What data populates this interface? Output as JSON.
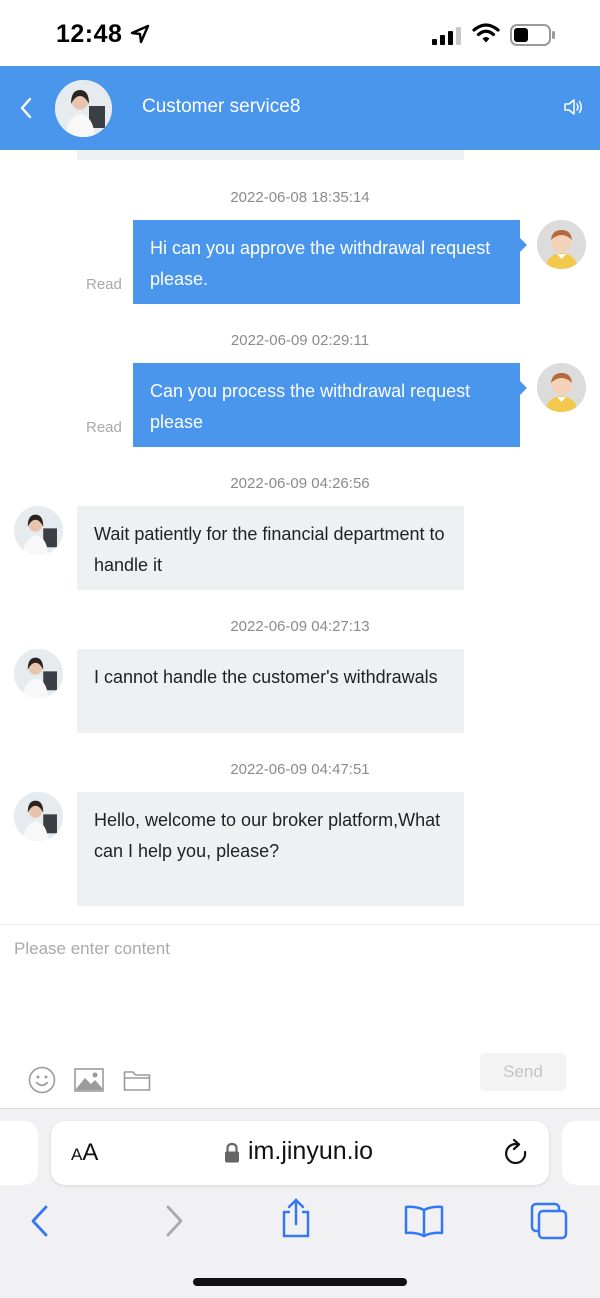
{
  "status_bar": {
    "time": "12:48"
  },
  "header": {
    "title": "Customer service8",
    "accent": "#4a96ec"
  },
  "messages": [
    {
      "timestamp": "2022-06-08 18:35:14",
      "from": "me",
      "text": "Hi can you approve the withdrawal request please.",
      "status": "Read"
    },
    {
      "timestamp": "2022-06-09 02:29:11",
      "from": "me",
      "text": "Can you process the withdrawal request please",
      "status": "Read"
    },
    {
      "timestamp": "2022-06-09 04:26:56",
      "from": "agent",
      "text": "Wait patiently for the financial department to handle it"
    },
    {
      "timestamp": "2022-06-09 04:27:13",
      "from": "agent",
      "text": "I cannot handle the customer's withdrawals"
    },
    {
      "timestamp": "2022-06-09 04:47:51",
      "from": "agent",
      "text": "Hello, welcome to our broker platform,What can I help you, please?"
    }
  ],
  "composer": {
    "placeholder": "Please enter content",
    "send_label": "Send"
  },
  "browser": {
    "aa_label": "A",
    "aa_label_big": "A",
    "url": "im.jinyun.io"
  }
}
